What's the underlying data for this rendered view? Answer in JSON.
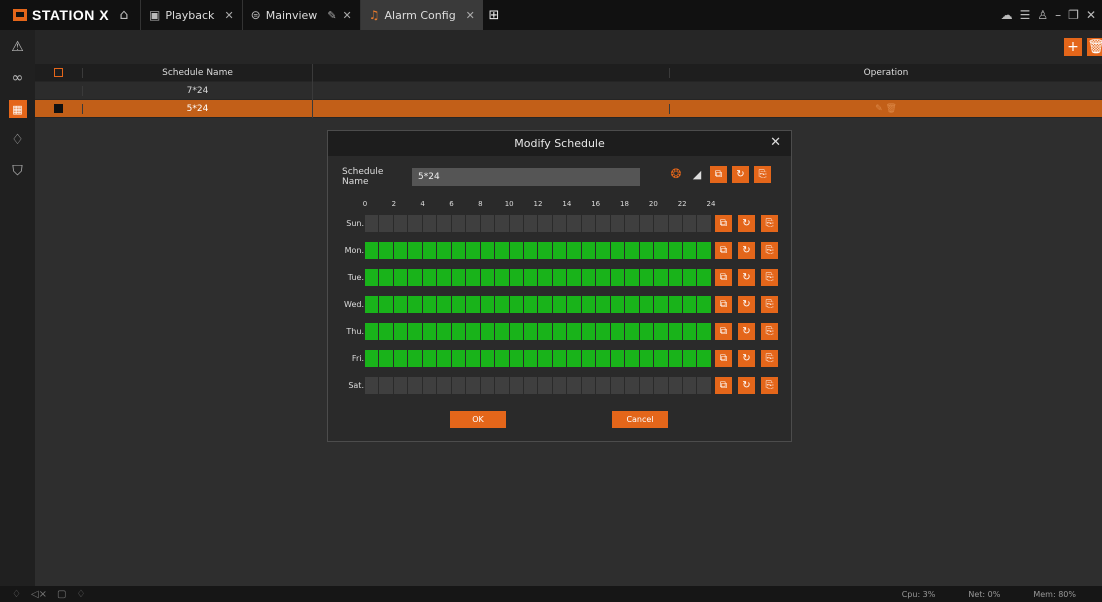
{
  "app": {
    "brand": "STATION X",
    "tabs": [
      {
        "label": "Playback",
        "icon": "playback-icon",
        "closable": true
      },
      {
        "label": "Mainview",
        "icon": "mainview-icon",
        "closable": true,
        "editable": true
      },
      {
        "label": "Alarm Config",
        "icon": "bell-icon",
        "closable": true,
        "active": true
      }
    ]
  },
  "table": {
    "columns": {
      "name": "Schedule Name",
      "operation": "Operation"
    },
    "rows": [
      {
        "name": "7*24",
        "checked": false,
        "selected": false
      },
      {
        "name": "5*24",
        "checked": true,
        "selected": true
      }
    ]
  },
  "modal": {
    "title": "Modify Schedule",
    "name_label": "Schedule Name",
    "name_value": "5*24",
    "hours": [
      "0",
      "2",
      "4",
      "6",
      "8",
      "10",
      "12",
      "14",
      "16",
      "18",
      "20",
      "22",
      "24"
    ],
    "days": [
      {
        "label": "Sun.",
        "active": false
      },
      {
        "label": "Mon.",
        "active": true
      },
      {
        "label": "Tue.",
        "active": true
      },
      {
        "label": "Wed.",
        "active": true
      },
      {
        "label": "Thu.",
        "active": true
      },
      {
        "label": "Fri.",
        "active": true
      },
      {
        "label": "Sat.",
        "active": false
      }
    ],
    "ok_label": "OK",
    "cancel_label": "Cancel"
  },
  "status": {
    "cpu": "Cpu: 3%",
    "net": "Net: 0%",
    "mem": "Mem: 80%"
  },
  "colors": {
    "accent": "#e4661a",
    "active_cell": "#19b31a",
    "inactive_cell": "#3f3f3f"
  }
}
